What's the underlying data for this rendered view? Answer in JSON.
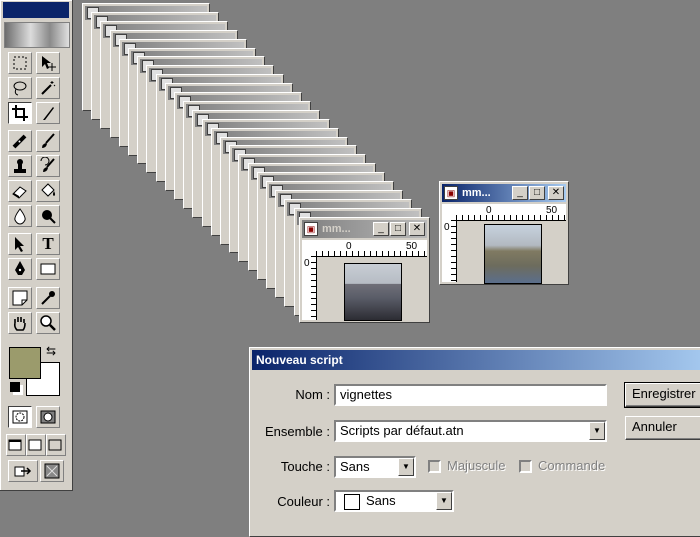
{
  "toolbox": {
    "tools": [
      {
        "name": "marquee-tool",
        "icon": "marquee-icon"
      },
      {
        "name": "move-tool",
        "icon": "move-icon"
      },
      {
        "name": "lasso-tool",
        "icon": "lasso-icon"
      },
      {
        "name": "magic-wand-tool",
        "icon": "magic-wand-icon"
      },
      {
        "name": "crop-tool",
        "icon": "crop-icon"
      },
      {
        "name": "slice-tool",
        "icon": "slice-icon"
      },
      {
        "name": "healing-brush-tool",
        "icon": "bandage-icon"
      },
      {
        "name": "brush-tool",
        "icon": "brush-icon"
      },
      {
        "name": "stamp-tool",
        "icon": "stamp-icon"
      },
      {
        "name": "history-brush-tool",
        "icon": "history-brush-icon"
      },
      {
        "name": "eraser-tool",
        "icon": "eraser-icon"
      },
      {
        "name": "paint-bucket-tool",
        "icon": "paint-bucket-icon"
      },
      {
        "name": "blur-tool",
        "icon": "droplet-icon"
      },
      {
        "name": "burn-tool",
        "icon": "burn-icon"
      },
      {
        "name": "path-select-tool",
        "icon": "arrow-icon"
      },
      {
        "name": "type-tool",
        "icon": "type-icon",
        "glyph": "T"
      },
      {
        "name": "pen-tool",
        "icon": "pen-icon"
      },
      {
        "name": "shape-tool",
        "icon": "rectangle-icon"
      },
      {
        "name": "notes-tool",
        "icon": "note-icon"
      },
      {
        "name": "eyedropper-tool",
        "icon": "eyedropper-icon"
      },
      {
        "name": "hand-tool",
        "icon": "hand-icon"
      },
      {
        "name": "zoom-tool",
        "icon": "magnifier-icon"
      }
    ],
    "foreground_color": "#9b9b6c",
    "background_color": "#ffffff"
  },
  "windows": {
    "stacked_title": "mm",
    "front": {
      "title": "mm...",
      "ruler_labels": [
        "0",
        "50"
      ]
    },
    "right": {
      "title": "mm...",
      "ruler_labels": [
        "0",
        "50"
      ]
    }
  },
  "dialog": {
    "title": "Nouveau script",
    "name_label": "Nom :",
    "name_value": "vignettes",
    "set_label": "Ensemble :",
    "set_value": "Scripts par défaut.atn",
    "key_label": "Touche :",
    "key_value": "Sans",
    "shift_label": "Majuscule",
    "command_label": "Commande",
    "color_label": "Couleur :",
    "color_value": "Sans",
    "record_button": "Enregistrer",
    "cancel_button": "Annuler"
  }
}
